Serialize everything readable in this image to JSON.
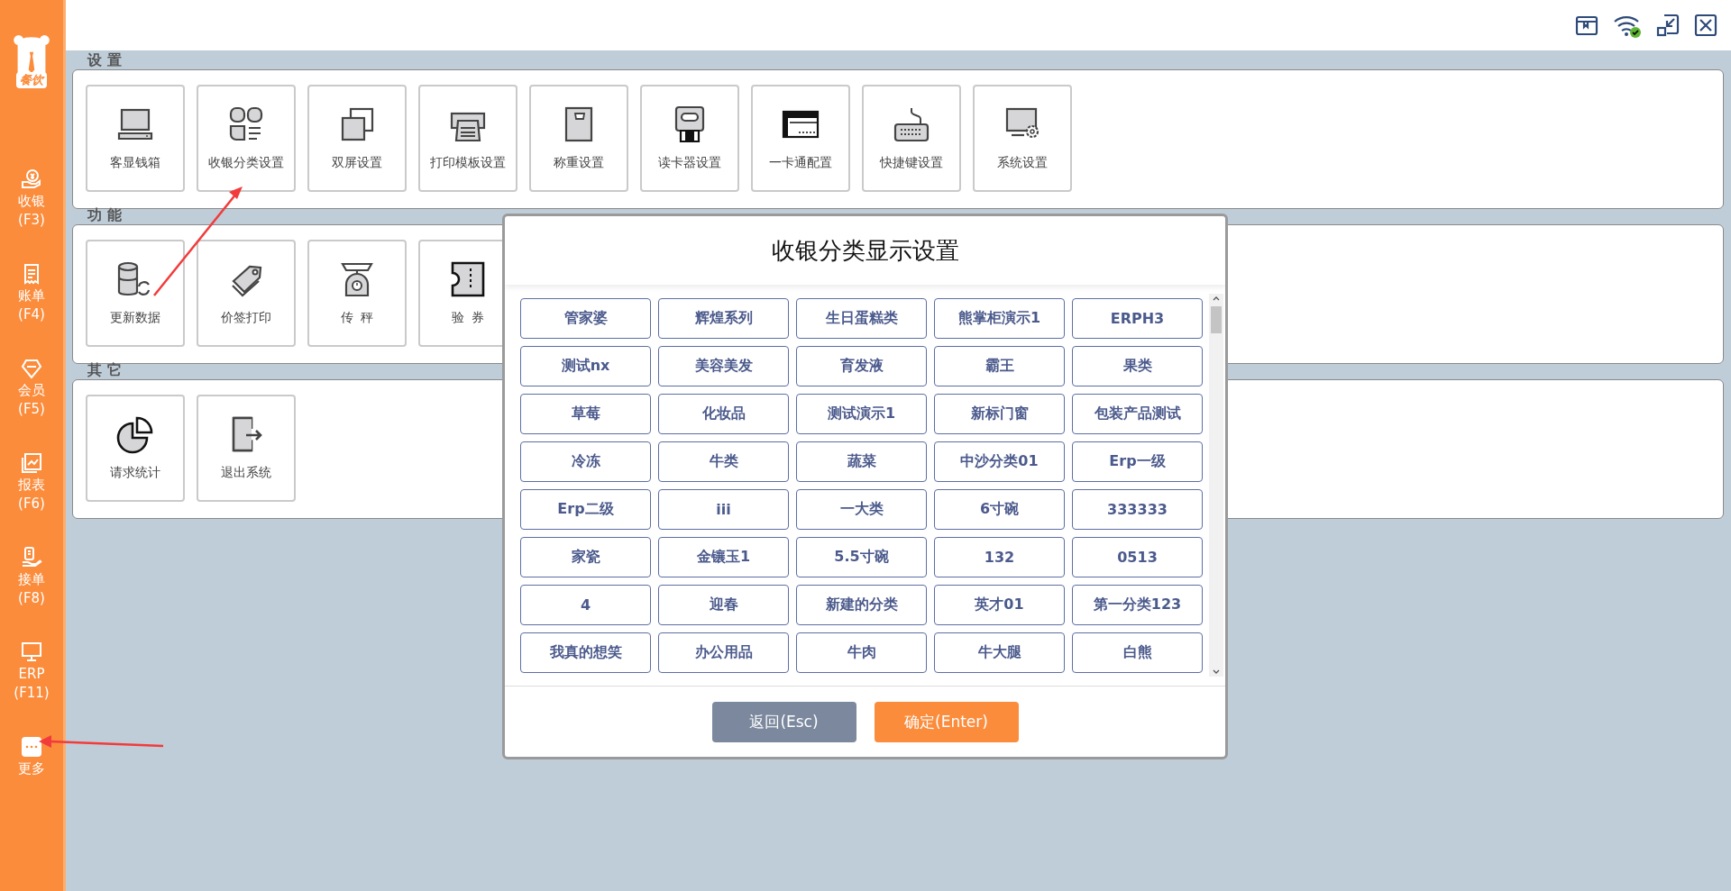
{
  "sidebar": {
    "logo_text": "餐饮",
    "items": [
      {
        "label": "收银",
        "shortcut": "(F3)"
      },
      {
        "label": "账单",
        "shortcut": "(F4)"
      },
      {
        "label": "会员",
        "shortcut": "(F5)"
      },
      {
        "label": "报表",
        "shortcut": "(F6)"
      },
      {
        "label": "接单",
        "shortcut": "(F8)"
      },
      {
        "label": "ERP",
        "shortcut": "(F11)"
      },
      {
        "label": "更多"
      }
    ]
  },
  "sections": [
    {
      "title": "设 置",
      "tiles": [
        "客显钱箱",
        "收银分类设置",
        "双屏设置",
        "打印模板设置",
        "称重设置",
        "读卡器设置",
        "一卡通配置",
        "快捷键设置",
        "系统设置"
      ]
    },
    {
      "title": "功 能",
      "tiles": [
        "更新数据",
        "价签打印",
        "传  秤",
        "验  券"
      ]
    },
    {
      "title": "其 它",
      "tiles": [
        "请求统计",
        "退出系统"
      ]
    }
  ],
  "dialog": {
    "title": "收银分类显示设置",
    "categories": [
      "管家婆",
      "辉煌系列",
      "生日蛋糕类",
      "熊掌柜演示1",
      "ERPH3",
      "测试nx",
      "美容美发",
      "育发液",
      "霸王",
      "果类",
      "草莓",
      "化妆品",
      "测试演示1",
      "新标门窗",
      "包装产品测试",
      "冷冻",
      "牛类",
      "蔬菜",
      "中沙分类01",
      "Erp一级",
      "Erp二级",
      "iii",
      "一大类",
      "6寸碗",
      "333333",
      "家瓷",
      "金镶玉1",
      "5.5寸碗",
      "132",
      "0513",
      "4",
      "迎春",
      "新建的分类",
      "英才01",
      "第一分类123",
      "我真的想笑",
      "办公用品",
      "牛肉",
      "牛大腿",
      "白熊"
    ],
    "buttons": [
      {
        "label": "返回(Esc)",
        "kind": "secondary"
      },
      {
        "label": "确定(Enter)",
        "kind": "primary"
      }
    ]
  }
}
